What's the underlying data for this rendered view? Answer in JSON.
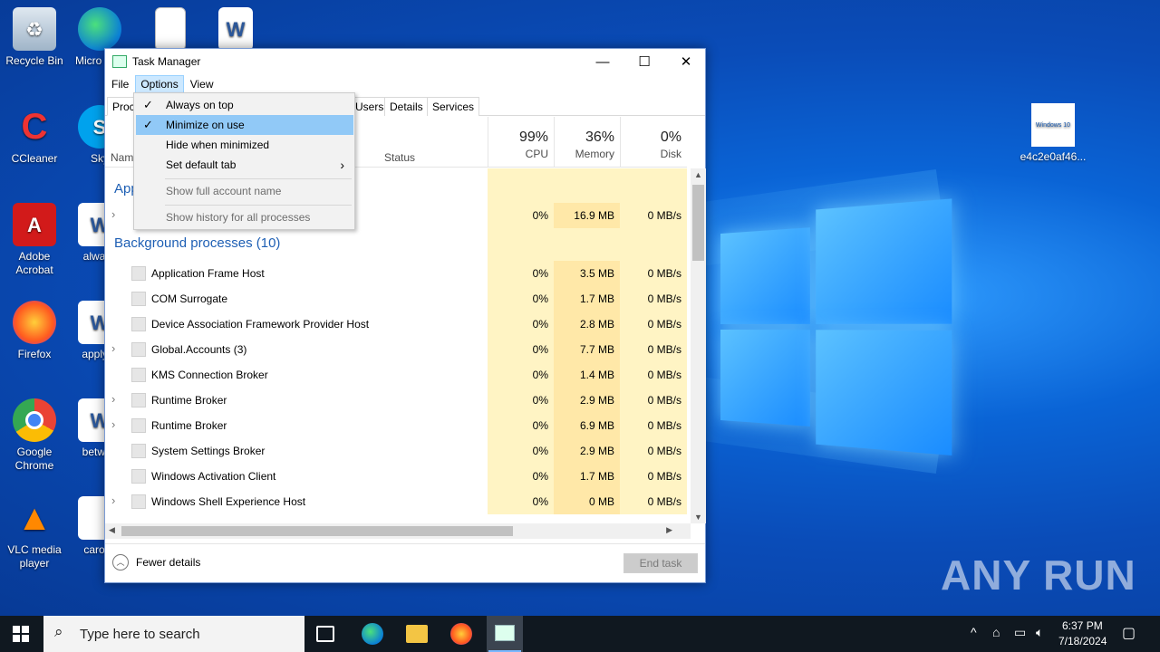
{
  "desktop": {
    "icons": [
      {
        "label": "Recycle Bin"
      },
      {
        "label": "Micro Edg"
      },
      {
        "label": ""
      },
      {
        "label": ""
      },
      {
        "label": "CCleaner"
      },
      {
        "label": "Sky"
      },
      {
        "label": "Adobe Acrobat"
      },
      {
        "label": "always"
      },
      {
        "label": "Firefox"
      },
      {
        "label": "applyar"
      },
      {
        "label": "Google Chrome"
      },
      {
        "label": "betwee"
      },
      {
        "label": "VLC media player"
      },
      {
        "label": "carolin"
      },
      {
        "label": "e4c2e0af46..."
      }
    ],
    "thumb_text": "Windows 10",
    "watermark": "ANY RUN"
  },
  "window": {
    "title": "Task Manager",
    "minimize": "—",
    "maximize": "☐",
    "close": "✕",
    "menu": [
      "File",
      "Options",
      "View"
    ],
    "tabs": [
      "Proc",
      "Users",
      "Details",
      "Services"
    ],
    "columns": {
      "name": "Nam",
      "status": "Status",
      "cpu_pct": "99%",
      "cpu": "CPU",
      "mem_pct": "36%",
      "mem": "Memory",
      "disk_pct": "0%",
      "disk": "Disk"
    },
    "apps_header": "App",
    "app_row": {
      "cpu": "0%",
      "mem": "16.9 MB",
      "disk": "0 MB/s"
    },
    "bg_header": "Background processes (10)",
    "processes": [
      {
        "name": "Application Frame Host",
        "cpu": "0%",
        "mem": "3.5 MB",
        "disk": "0 MB/s",
        "expand": ""
      },
      {
        "name": "COM Surrogate",
        "cpu": "0%",
        "mem": "1.7 MB",
        "disk": "0 MB/s",
        "expand": ""
      },
      {
        "name": "Device Association Framework Provider Host",
        "cpu": "0%",
        "mem": "2.8 MB",
        "disk": "0 MB/s",
        "expand": ""
      },
      {
        "name": "Global.Accounts (3)",
        "cpu": "0%",
        "mem": "7.7 MB",
        "disk": "0 MB/s",
        "expand": "›"
      },
      {
        "name": "KMS Connection Broker",
        "cpu": "0%",
        "mem": "1.4 MB",
        "disk": "0 MB/s",
        "expand": ""
      },
      {
        "name": "Runtime Broker",
        "cpu": "0%",
        "mem": "2.9 MB",
        "disk": "0 MB/s",
        "expand": "›"
      },
      {
        "name": "Runtime Broker",
        "cpu": "0%",
        "mem": "6.9 MB",
        "disk": "0 MB/s",
        "expand": "›"
      },
      {
        "name": "System Settings Broker",
        "cpu": "0%",
        "mem": "2.9 MB",
        "disk": "0 MB/s",
        "expand": ""
      },
      {
        "name": "Windows Activation Client",
        "cpu": "0%",
        "mem": "1.7 MB",
        "disk": "0 MB/s",
        "expand": ""
      },
      {
        "name": "Windows Shell Experience Host",
        "cpu": "0%",
        "mem": "0 MB",
        "disk": "0 MB/s",
        "expand": "›"
      }
    ],
    "fewer_details": "Fewer details",
    "end_task": "End task"
  },
  "options_menu": {
    "items": [
      {
        "label": "Always on top",
        "checked": true
      },
      {
        "label": "Minimize on use",
        "checked": true
      },
      {
        "label": "Hide when minimized",
        "checked": false
      },
      {
        "label": "Set default tab",
        "checked": false
      },
      {
        "label": "Show full account name",
        "checked": false
      },
      {
        "label": "Show history for all processes",
        "checked": false
      }
    ],
    "check_glyph": "✓",
    "submenu_arrow": "›"
  },
  "taskbar": {
    "search_placeholder": "Type here to search",
    "time": "6:37 PM",
    "date": "7/18/2024"
  }
}
